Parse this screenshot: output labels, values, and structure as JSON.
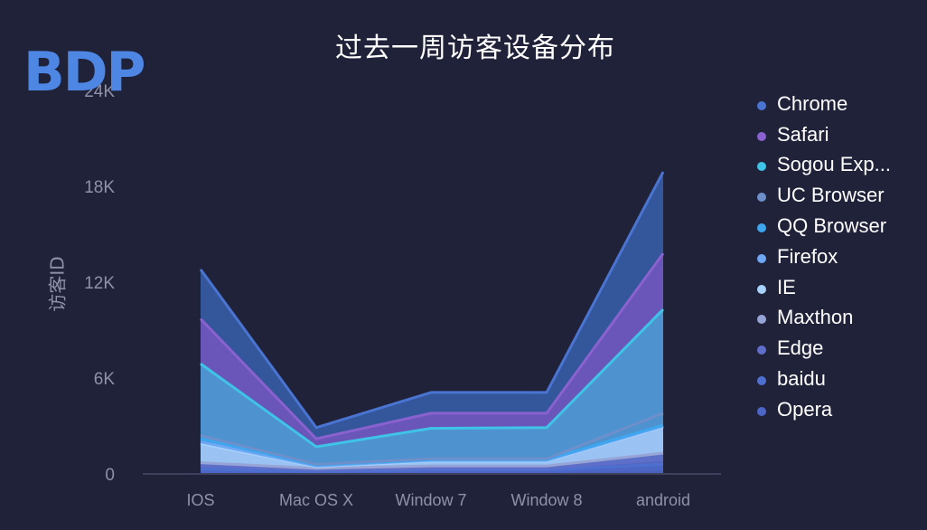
{
  "logo": {
    "text": "BDP"
  },
  "chart_data": {
    "type": "area",
    "stacked": true,
    "title": "过去一周访客设备分布",
    "xlabel": "",
    "ylabel": "访客ID",
    "categories": [
      "IOS",
      "Mac OS X",
      "Window 7",
      "Window 8",
      "android"
    ],
    "ylim": [
      0,
      24000
    ],
    "yticks": [
      0,
      6000,
      12000,
      18000,
      24000
    ],
    "ytick_labels": [
      "0",
      "6K",
      "12K",
      "18K",
      "24K"
    ],
    "legend_position": "right",
    "series": [
      {
        "name": "Chrome",
        "color": "#4a74d2",
        "fill": "#34569a",
        "values": [
          3100,
          700,
          1300,
          1300,
          5100
        ]
      },
      {
        "name": "Safari",
        "color": "#8a62d0",
        "fill": "#6a55b8",
        "values": [
          2800,
          500,
          950,
          900,
          3500
        ]
      },
      {
        "name": "Sogou Exp...",
        "color": "#3fc3e6",
        "fill": "#4e93cf",
        "values": [
          4500,
          1100,
          1900,
          1950,
          6500
        ]
      },
      {
        "name": "UC Browser",
        "color": "#6d8fca",
        "fill": "#4e93cf",
        "values": [
          200,
          50,
          50,
          50,
          750
        ]
      },
      {
        "name": "QQ Browser",
        "color": "#3ea6ee",
        "fill": "#4e93cf",
        "values": [
          200,
          50,
          50,
          50,
          50
        ]
      },
      {
        "name": "Firefox",
        "color": "#6fa7f4",
        "fill": "#6fa2e3",
        "values": [
          100,
          50,
          50,
          50,
          50
        ]
      },
      {
        "name": "IE",
        "color": "#a6d2fb",
        "fill": "#9ac2f2",
        "values": [
          1200,
          100,
          300,
          300,
          1650
        ]
      },
      {
        "name": "Maxthon",
        "color": "#97a5d6",
        "fill": "#5d70c8",
        "values": [
          200,
          100,
          150,
          150,
          400
        ]
      },
      {
        "name": "Edge",
        "color": "#5f6ec8",
        "fill": "#5468c2",
        "values": [
          200,
          100,
          100,
          100,
          300
        ]
      },
      {
        "name": "baidu",
        "color": "#4d70d0",
        "fill": "#4d66bf",
        "values": [
          200,
          50,
          100,
          100,
          300
        ]
      },
      {
        "name": "Opera",
        "color": "#4c66c8",
        "fill": "#4a62bb",
        "values": [
          100,
          100,
          150,
          150,
          300
        ]
      }
    ]
  }
}
